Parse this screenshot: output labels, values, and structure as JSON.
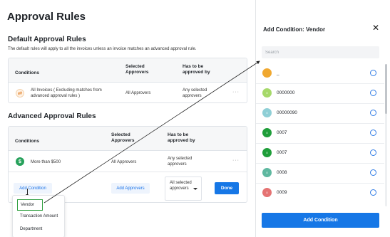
{
  "page": {
    "title": "Approval Rules",
    "default_section": {
      "title": "Default Approval Rules",
      "subtitle": "The default rules will apply to all the invoices unless an invoice matches an advanced approval rule.",
      "headers": [
        "Conditions",
        "Selected Approvers",
        "Has to be approved by"
      ],
      "row": {
        "icon": "transaction-icon",
        "condition": "All Invoices ( Excluding matches from advanced approval rules )",
        "approvers": "All Approvers",
        "approved_by": "Any selected approvers",
        "more": "···"
      }
    },
    "advanced_section": {
      "title": "Advanced Approval Rules",
      "headers": [
        "Conditions",
        "Selected Approvers",
        "Has to be approved by"
      ],
      "row": {
        "icon": "dollar-icon",
        "condition": "More than $500",
        "approvers": "All Approvers",
        "approved_by": "Any selected approvers",
        "more": "···"
      },
      "editor": {
        "add_condition": "Add Condition",
        "add_approvers": "Add Approvers",
        "approved_by_select": "All selected approvers",
        "done": "Done"
      }
    },
    "condition_menu": [
      "Vendor",
      "Transaction Amount",
      "Department"
    ]
  },
  "panel": {
    "title": "Add Condition: Vendor",
    "search_placeholder": "Search",
    "options": [
      {
        "label": "_",
        "color": "#f0a830",
        "avatar_text": ""
      },
      {
        "label": "0000000",
        "color": "#a6d96a",
        "avatar_text": "0"
      },
      {
        "label": "00000090",
        "color": "#8fcfd6",
        "avatar_text": "0"
      },
      {
        "label": "0007",
        "color": "#1f9e3a",
        "avatar_text": "0"
      },
      {
        "label": "0007",
        "color": "#1f9e3a",
        "avatar_text": "0"
      },
      {
        "label": "0008",
        "color": "#5fb8a0",
        "avatar_text": "0"
      },
      {
        "label": "0009",
        "color": "#e57373",
        "avatar_text": "0"
      }
    ],
    "footer_button": "Add Condition"
  }
}
